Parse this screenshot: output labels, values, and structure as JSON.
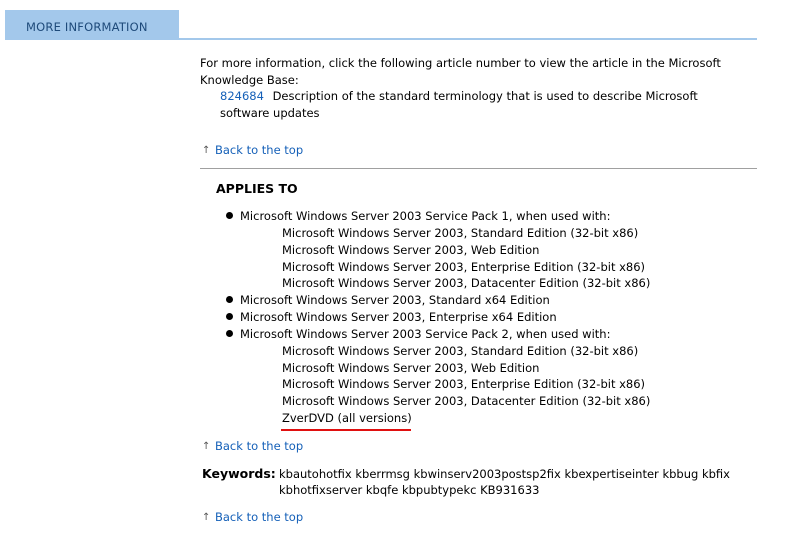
{
  "header": {
    "tab_label": "MORE INFORMATION"
  },
  "intro": {
    "line1": "For more information, click the following article number to view the article in the Microsoft",
    "line2": "Knowledge Base:"
  },
  "article": {
    "number": "824684",
    "desc_line1": "Description of the standard terminology that is used to describe Microsoft",
    "desc_line2": "software updates"
  },
  "back_to_top": "Back to the top",
  "applies_to": {
    "title": "APPLIES TO",
    "groups": [
      {
        "label": "Microsoft Windows Server 2003 Service Pack 1, when used with:",
        "sub": [
          "Microsoft Windows Server 2003, Standard Edition (32-bit x86)",
          "Microsoft Windows Server 2003, Web Edition",
          "Microsoft Windows Server 2003, Enterprise Edition (32-bit x86)",
          "Microsoft Windows Server 2003, Datacenter Edition (32-bit x86)"
        ]
      },
      {
        "label": "Microsoft Windows Server 2003, Standard x64 Edition",
        "sub": []
      },
      {
        "label": "Microsoft Windows Server 2003, Enterprise x64 Edition",
        "sub": []
      },
      {
        "label": "Microsoft Windows Server 2003 Service Pack 2, when used with:",
        "sub": [
          "Microsoft Windows Server 2003, Standard Edition (32-bit x86)",
          "Microsoft Windows Server 2003, Web Edition",
          "Microsoft Windows Server 2003, Enterprise Edition (32-bit x86)",
          "Microsoft Windows Server 2003, Datacenter Edition (32-bit x86)",
          "ZverDVD (all versions)"
        ]
      }
    ]
  },
  "keywords": {
    "label": "Keywords:",
    "line1": "kbautohotfix kberrmsg kbwinserv2003postsp2fix kbexpertiseinter kbbug kbfix",
    "line2": "kbhotfixserver kbqfe kbpubtypekc KB931633"
  },
  "colors": {
    "header_bg": "#a3c8eb",
    "link": "#1560b8",
    "highlight_underline": "#e01010"
  }
}
